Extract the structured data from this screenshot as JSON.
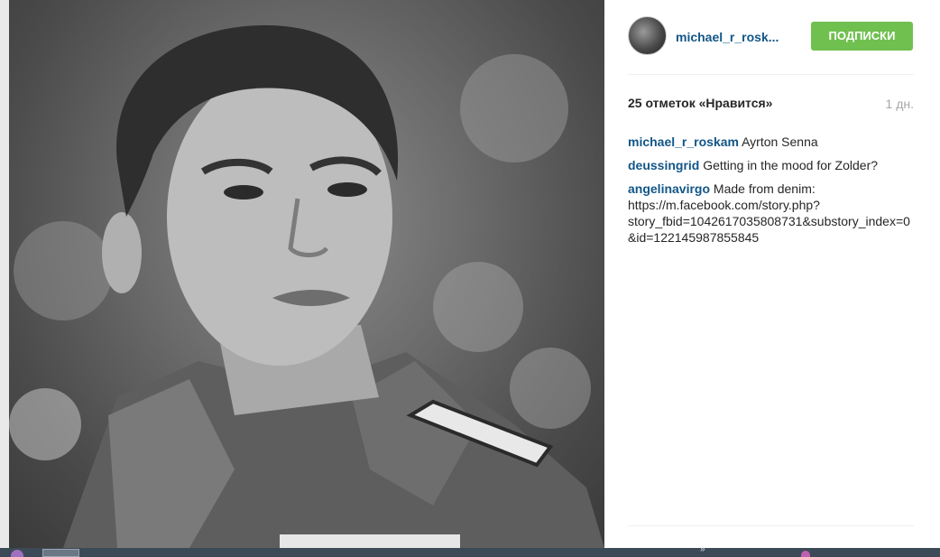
{
  "post": {
    "username": "michael_r_rosk...",
    "follow_label": "ПОДПИСКИ",
    "likes": "25 отметок «Нравится»",
    "time_ago": "1 дн.",
    "comments": [
      {
        "author": "michael_r_roskam",
        "text": " Ayrton Senna"
      },
      {
        "author": "deussingrid",
        "text": " Getting in the mood for Zolder?"
      },
      {
        "author": "angelinavirgo",
        "text": " Made from denim: https://m.facebook.com/story.php?story_fbid=1042617035808731&substory_index=0&id=122145987855845"
      }
    ]
  },
  "photo": {
    "description_icon": "portrait-photo",
    "style": "black-and-white"
  },
  "colors": {
    "accent": "#125688",
    "follow": "#70c050",
    "muted": "#a5a7aa"
  },
  "taskbar": {
    "overflow_label": "»"
  }
}
